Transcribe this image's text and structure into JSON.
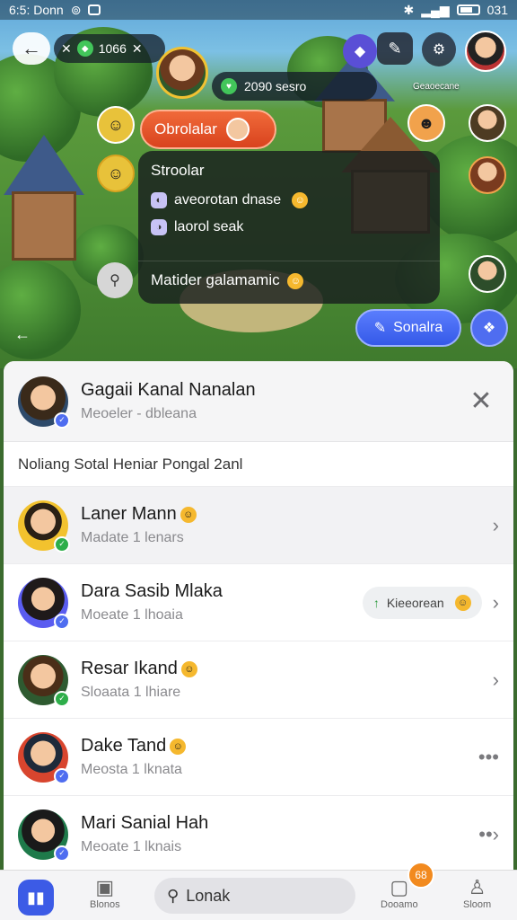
{
  "status_bar": {
    "time": "6:5: Donn",
    "right": "031"
  },
  "hud": {
    "currency": "1066",
    "score": "2090 sesro",
    "small_label": "Geaoecane",
    "red_button": "Obrolalar",
    "chat_title": "Stroolar",
    "chat_row1": "aveorotan dnase",
    "chat_row2": "laorol seak",
    "chat_footer": "Matider galamamic",
    "blue_button": "Sonalra"
  },
  "sheet": {
    "header": {
      "name": "Gagaii Kanal Nanalan",
      "subtitle": "Meoeler - dbleana"
    },
    "section_label": "Noliang Sotal Heniar Pongal 2anl",
    "friends": [
      {
        "name": "Laner Mann",
        "status": "Madate 1 lenars"
      },
      {
        "name": "Dara Sasib Mlaka",
        "status": "Moeate 1 lhoaia",
        "chip": "Kieeorean"
      },
      {
        "name": "Resar Ikand",
        "status": "Sloaata 1 lhiare"
      },
      {
        "name": "Dake Tand",
        "status": "Meosta 1 lknata"
      },
      {
        "name": "Mari Sanial Hah",
        "status": "Meoate 1 lknais"
      }
    ]
  },
  "nav": {
    "item1_label": "Blonos",
    "search_text": "Lonak",
    "badge_count": "68",
    "item4_label": "Dooamo",
    "item5_label": "Sloom"
  },
  "colors": {
    "accent": "#3c5be6",
    "red_button": "#e2502a",
    "badge": "#f28a1f"
  }
}
